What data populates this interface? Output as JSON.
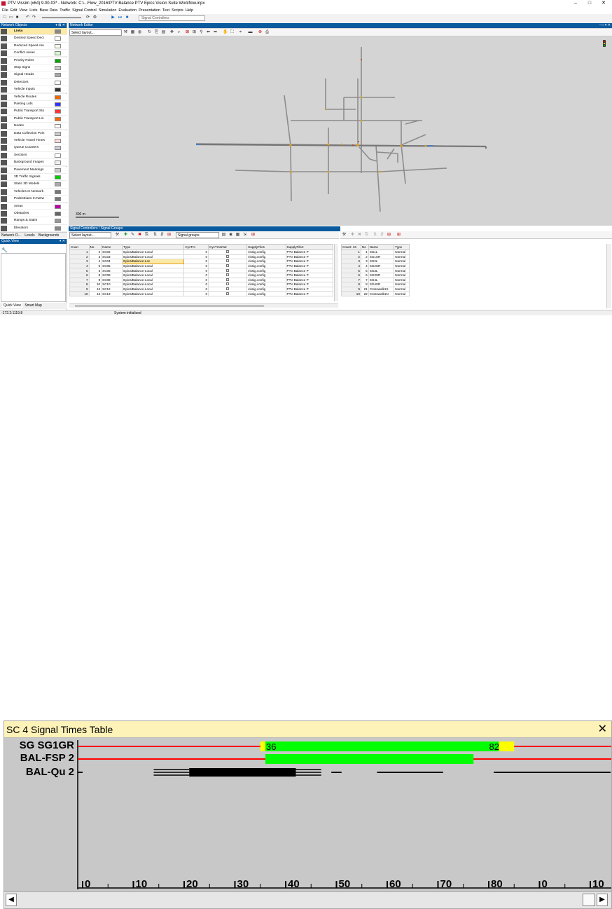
{
  "window": {
    "title": "PTV Vissim (x64) 9.00-03* - Network: C:\\...Flow_2016\\PTV Balance PTV Epics Vision Suite Workflow.inpx"
  },
  "menu": [
    "File",
    "Edit",
    "View",
    "Lists",
    "Base Data",
    "Traffic",
    "Signal Control",
    "Simulation",
    "Evaluation",
    "Presentation",
    "Test",
    "Scripts",
    "Help"
  ],
  "toolbar": {
    "combo": "Signal Controllers"
  },
  "network_objects": {
    "title": "Network Objects",
    "items": [
      "Links",
      "Desired Speed Deci",
      "Reduced Speed Are",
      "Conflict Areas",
      "Priority Rules",
      "Stop Signs",
      "Signal Heads",
      "Detectors",
      "Vehicle Inputs",
      "Vehicle Routes",
      "Parking Lots",
      "Public Transport Sto",
      "Public Transport Lin",
      "Nodes",
      "Data Collection Poin",
      "Vehicle Travel Times",
      "Queue Counters",
      "Sections",
      "Background Images",
      "Pavement Markings",
      "3D Traffic Signals",
      "Static 3D Models",
      "Vehicles In Network",
      "Pedestrians In Netw",
      "Areas",
      "Obstacles",
      "Ramps & Stairs",
      "Elevators"
    ],
    "tabs": [
      "Network O...",
      "Levels",
      "Backgrounds"
    ]
  },
  "quick_view": {
    "title": "Quick View",
    "tabs": [
      "Quick View",
      "Smart Map"
    ]
  },
  "network_editor": {
    "title": "Network Editor",
    "layout_placeholder": "Select layout...",
    "scale": "300 m"
  },
  "sc_panel": {
    "title": "Signal Controllers / Signal Groups",
    "layout_placeholder": "Select layout...",
    "relation": "Signal groups",
    "columns": [
      "Coun",
      "No",
      "Name",
      "Type",
      "CycTm",
      "CycTmIsVar",
      "SupplyFile1",
      "SupplyFile2"
    ],
    "rows": [
      [
        "1",
        "2",
        "SC02",
        "Epics/Balance-Local",
        "0",
        "",
        "vissig.config",
        "PTV Balance P"
      ],
      [
        "2",
        "3",
        "SC03",
        "Epics/Balance-Local",
        "0",
        "",
        "vissig.config",
        "PTV Balance P"
      ],
      [
        "3",
        "4",
        "SC04",
        "Epics/Balance-Loc",
        "0",
        "",
        "vissig.config",
        "PTV Balance P"
      ],
      [
        "4",
        "5",
        "SC05",
        "Epics/Balance-Local",
        "0",
        "",
        "vissig.config",
        "PTV Balance P"
      ],
      [
        "5",
        "6",
        "SC06",
        "Epics/Balance-Local",
        "0",
        "",
        "vissig.config",
        "PTV Balance P"
      ],
      [
        "6",
        "8",
        "SC08",
        "Epics/Balance-Local",
        "0",
        "",
        "vissig.config",
        "PTV Balance P"
      ],
      [
        "7",
        "9",
        "SC09",
        "Epics/Balance-Local",
        "0",
        "",
        "vissig.config",
        "PTV Balance P"
      ],
      [
        "8",
        "10",
        "SC10",
        "Epics/Balance-Local",
        "0",
        "",
        "vissig.config",
        "PTV Balance P"
      ],
      [
        "9",
        "12",
        "SC12",
        "Epics/Balance-Local",
        "0",
        "",
        "vissig.config",
        "PTV Balance P"
      ],
      [
        "10",
        "13",
        "SC13",
        "Epics/Balance-Local",
        "0",
        "",
        "vissig.config",
        "PTV Balance P"
      ]
    ]
  },
  "sg_panel": {
    "columns": [
      "Count: 16",
      "No",
      "Name",
      "Type"
    ],
    "rows": [
      [
        "1",
        "1",
        "SG1L",
        "Normal"
      ],
      [
        "2",
        "2",
        "SG1SR",
        "Normal"
      ],
      [
        "3",
        "3",
        "SG2L",
        "Normal"
      ],
      [
        "4",
        "4",
        "SG2SR",
        "Normal"
      ],
      [
        "5",
        "5",
        "SG3L",
        "Normal"
      ],
      [
        "6",
        "6",
        "SG3SR",
        "Normal"
      ],
      [
        "7",
        "7",
        "SG4L",
        "Normal"
      ],
      [
        "8",
        "8",
        "SG4SR",
        "Normal"
      ],
      [
        "9",
        "21",
        "Crosswalk1S",
        "Normal"
      ],
      [
        "10",
        "22",
        "Crosswalk1N",
        "Normal"
      ]
    ]
  },
  "status": {
    "coords": "-172.2:1119.8",
    "message": "System initialized"
  },
  "signal_times": {
    "title": "SC 4 Signal Times Table",
    "rows": [
      {
        "label": "SG SG1GR"
      },
      {
        "label": "BAL-FSP  2"
      },
      {
        "label": "BAL-Qu  2"
      }
    ],
    "green_start": 36,
    "green_end": 82,
    "ticks": [
      "0",
      "10",
      "20",
      "30",
      "40",
      "50",
      "60",
      "70",
      "80",
      "0",
      "10"
    ],
    "colors": {
      "red": "#ff0000",
      "green": "#00ff00",
      "amber": "#ffff00"
    }
  }
}
